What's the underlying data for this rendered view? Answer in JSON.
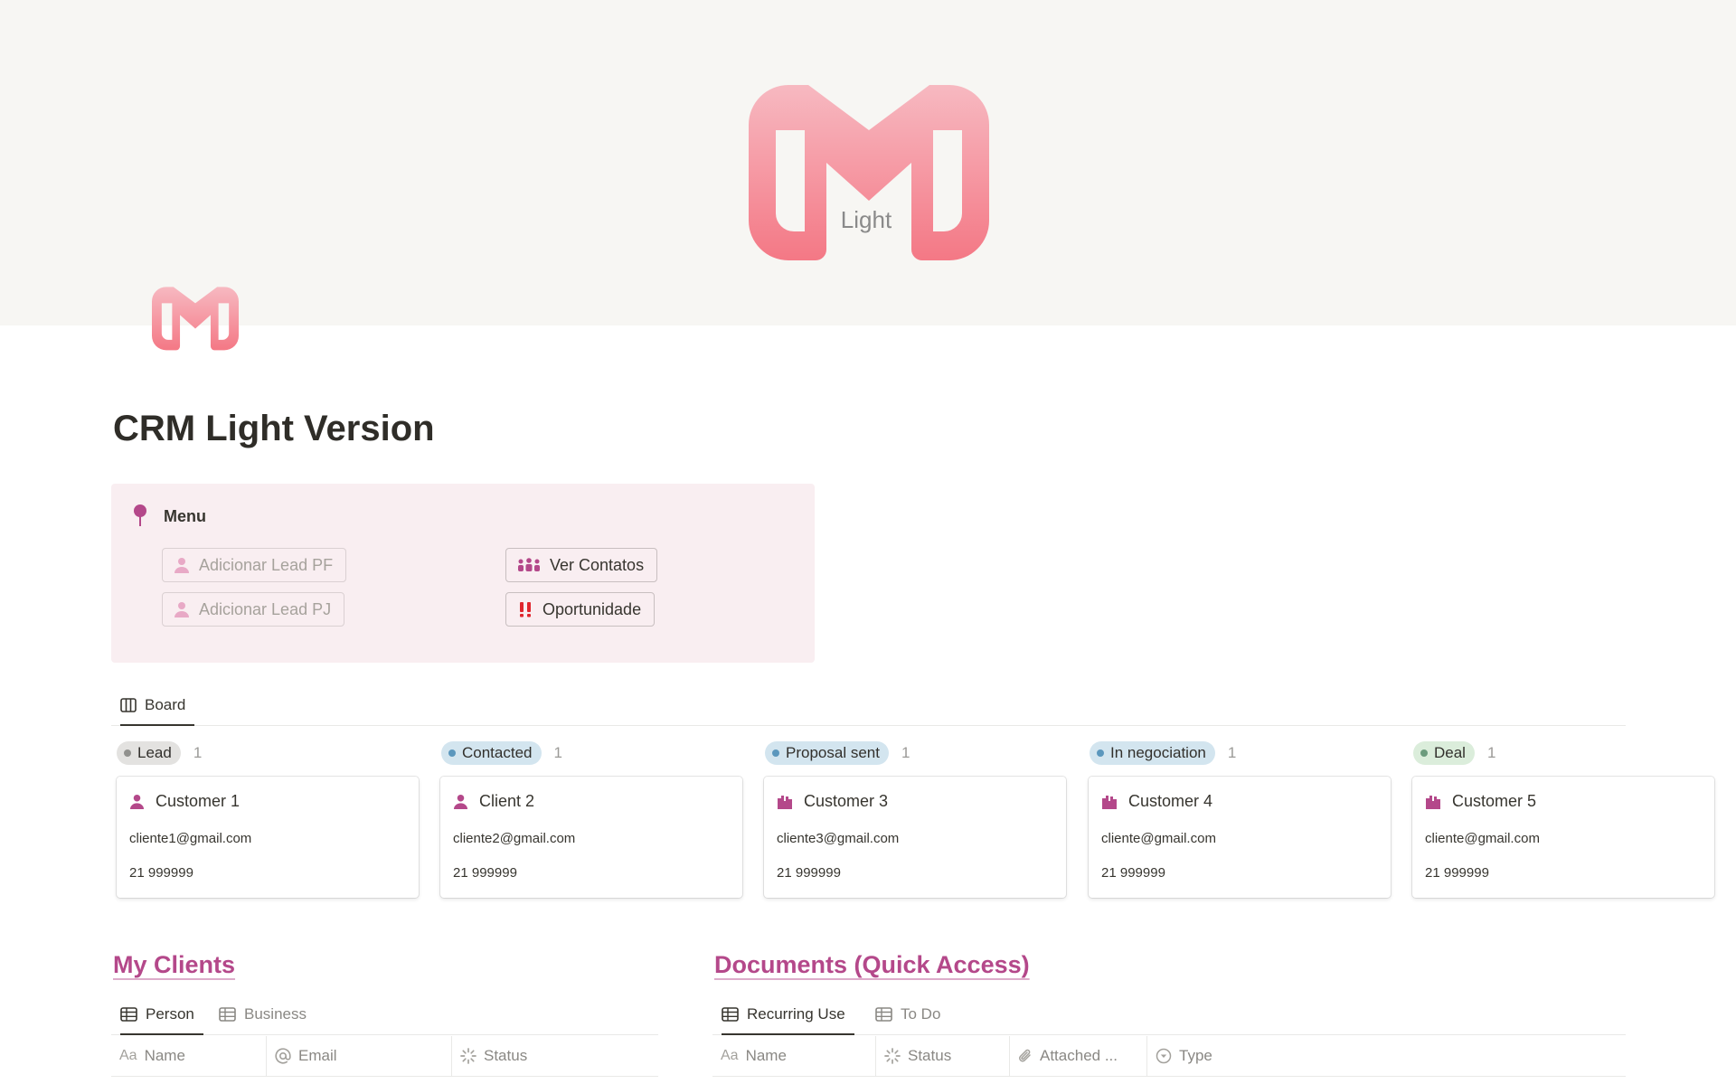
{
  "cover": {
    "logo_text": "Light"
  },
  "page": {
    "title": "CRM Light Version"
  },
  "menu": {
    "title": "Menu",
    "icon": "pushpin-icon",
    "buttons": [
      {
        "label": "Adicionar Lead PF",
        "icon": "person-icon"
      },
      {
        "label": "Adicionar Lead PJ",
        "icon": "person-icon"
      },
      {
        "label": "Ver Contatos",
        "icon": "people-icon"
      },
      {
        "label": "Oportunidade",
        "icon": "double-exclamation-icon"
      }
    ]
  },
  "board": {
    "view_tab": "Board",
    "columns": [
      {
        "status": "Lead",
        "count": "1",
        "pill_color": "#e3e2e0",
        "dot_color": "#91918e",
        "card": {
          "name": "Customer 1",
          "icon": "person-icon",
          "email": "cliente1@gmail.com",
          "phone": "21 999999"
        }
      },
      {
        "status": "Contacted",
        "count": "1",
        "pill_color": "#d3e5ef",
        "dot_color": "#5b97bd",
        "card": {
          "name": "Client 2",
          "icon": "person-icon",
          "email": "cliente2@gmail.com",
          "phone": "21 999999"
        }
      },
      {
        "status": "Proposal sent",
        "count": "1",
        "pill_color": "#d3e5ef",
        "dot_color": "#5b97bd",
        "card": {
          "name": "Customer 3",
          "icon": "building-icon",
          "email": "cliente3@gmail.com",
          "phone": "21 999999"
        }
      },
      {
        "status": "In negociation",
        "count": "1",
        "pill_color": "#d3e5ef",
        "dot_color": "#5b97bd",
        "card": {
          "name": "Customer 4",
          "icon": "building-icon",
          "email": "cliente@gmail.com",
          "phone": "21 999999"
        }
      },
      {
        "status": "Deal",
        "count": "1",
        "pill_color": "#dbeddb",
        "dot_color": "#6c9b7d",
        "card": {
          "name": "Customer 5",
          "icon": "building-icon",
          "email": "cliente@gmail.com",
          "phone": "21 999999"
        }
      }
    ]
  },
  "my_clients": {
    "title": "My Clients",
    "tabs": [
      "Person",
      "Business"
    ],
    "columns": [
      "Name",
      "Email",
      "Status"
    ]
  },
  "documents": {
    "title": "Documents (Quick Access)",
    "tabs": [
      "Recurring Use",
      "To Do"
    ],
    "columns": [
      "Name",
      "Status",
      "Attached ...",
      "Type"
    ]
  },
  "colors": {
    "accent": "#b4488a",
    "callout_bg": "#f9eef1",
    "logo_pink": "#f47f8c"
  }
}
